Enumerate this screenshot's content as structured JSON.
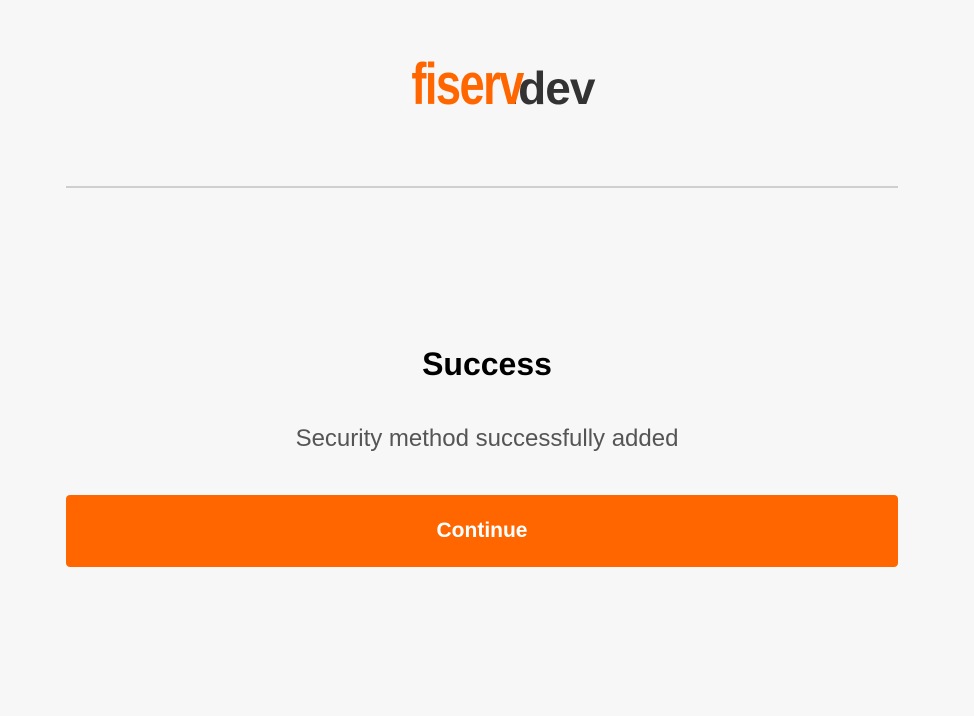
{
  "logo": {
    "brand": "fiserv",
    "suffix": ".dev"
  },
  "status": {
    "title": "Success",
    "message": "Security method successfully added"
  },
  "actions": {
    "continue_label": "Continue"
  },
  "colors": {
    "brand_orange": "#ff6600",
    "logo_dark": "#333333",
    "message_text": "#555555",
    "button_bg": "#ff6600",
    "background": "#f7f7f7"
  }
}
